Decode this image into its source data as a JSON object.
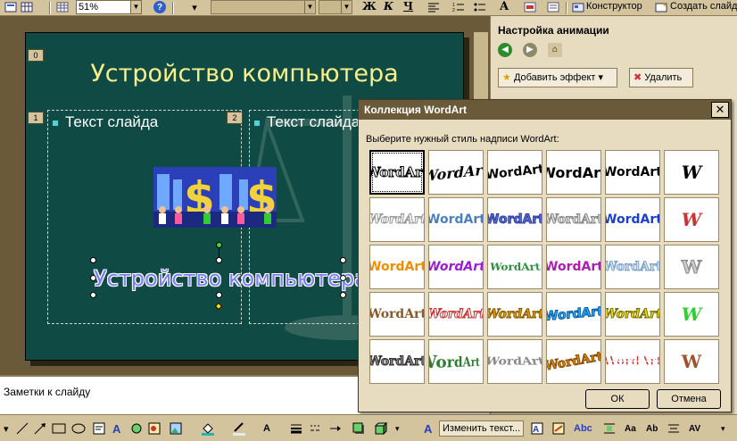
{
  "toolbar": {
    "zoom": "51%",
    "help_glyph": "?",
    "bold": "Ж",
    "italic": "К",
    "underline": "Ч",
    "font_size_up": "A",
    "designer_label": "Конструктор",
    "create_slide_label": "Создать слайд"
  },
  "slide": {
    "title": "Устройство компьютера",
    "ph_title_num": "0",
    "ph_left_num": "1",
    "ph_right_num": "2",
    "left_bullet": "Текст слайда",
    "right_bullet": "Текст слайда",
    "wordart_text": "Устройство компьютера"
  },
  "notes": {
    "placeholder": "Заметки к слайду"
  },
  "taskpane": {
    "title": "Настройка анимации",
    "add_effect": "Добавить эффект",
    "remove": "Удалить"
  },
  "dialog": {
    "title": "Коллекция WordArt",
    "close_glyph": "✕",
    "prompt": "Выберите нужный стиль надписи WordArt:",
    "styles": [
      "WordArt",
      "WordArt",
      "WordArt",
      "WordArt",
      "WordArt",
      "W",
      "WordArt",
      "WordArt",
      "WordArt",
      "WordArt",
      "WordArt",
      "W",
      "WordArt",
      "WordArt",
      "WordArt",
      "WordArt",
      "WordArt",
      "W",
      "WordArt",
      "WordArt",
      "WordArt",
      "WordArt",
      "WordArt",
      "W",
      "WordArt",
      "WordArt",
      "WordArt",
      "WordArt",
      "WordArt",
      "W"
    ],
    "ok": "ОК",
    "cancel": "Отмена"
  },
  "drawbar": {
    "edit_text": "Изменить текст..."
  },
  "colors": {
    "slide_bg": "#0f4a44",
    "title_color": "#f7f08a",
    "wordart_color": "#7b7ff5",
    "chrome": "#d4c49e",
    "dialog_title_bg": "#6b5a39"
  }
}
